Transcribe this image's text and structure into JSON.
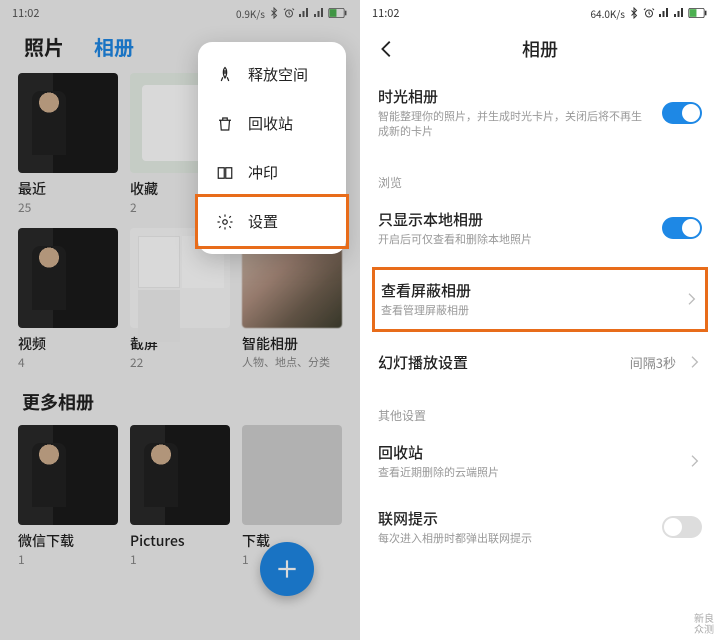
{
  "left": {
    "status": {
      "time": "11:02",
      "speed": "0.9K/s",
      "battery": "47"
    },
    "tabs": {
      "photos": "照片",
      "albums": "相册"
    },
    "albums_row1": [
      {
        "name": "最近",
        "count": "25"
      },
      {
        "name": "收藏",
        "count": "2"
      }
    ],
    "albums_row2": [
      {
        "name": "视频",
        "count": "4"
      },
      {
        "name": "截屏",
        "count": "22"
      },
      {
        "name": "智能相册",
        "sub": "人物、地点、分类"
      }
    ],
    "more_title": "更多相册",
    "albums_row3": [
      {
        "name": "微信下载",
        "count": "1"
      },
      {
        "name": "Pictures",
        "count": "1"
      },
      {
        "name": "下载",
        "count": "1"
      }
    ],
    "menu": {
      "free_space": "释放空间",
      "recycle": "回收站",
      "print": "冲印",
      "settings": "设置"
    }
  },
  "right": {
    "status": {
      "time": "11:02",
      "speed": "64.0K/s",
      "battery": "47"
    },
    "header": "相册",
    "time_album": {
      "title": "时光相册",
      "sub": "智能整理你的照片，并生成时光卡片，关闭后将不再生成新的卡片"
    },
    "browse_label": "浏览",
    "local_only": {
      "title": "只显示本地相册",
      "sub": "开启后可仅查看和删除本地照片"
    },
    "blocked": {
      "title": "查看屏蔽相册",
      "sub": "查看管理屏蔽相册"
    },
    "slideshow": {
      "title": "幻灯播放设置",
      "value": "间隔3秒"
    },
    "other_label": "其他设置",
    "recycle": {
      "title": "回收站",
      "sub": "查看近期删除的云端照片"
    },
    "network": {
      "title": "联网提示",
      "sub": "每次进入相册时都弹出联网提示"
    }
  },
  "watermark": {
    "l1": "新良",
    "l2": "众测"
  }
}
